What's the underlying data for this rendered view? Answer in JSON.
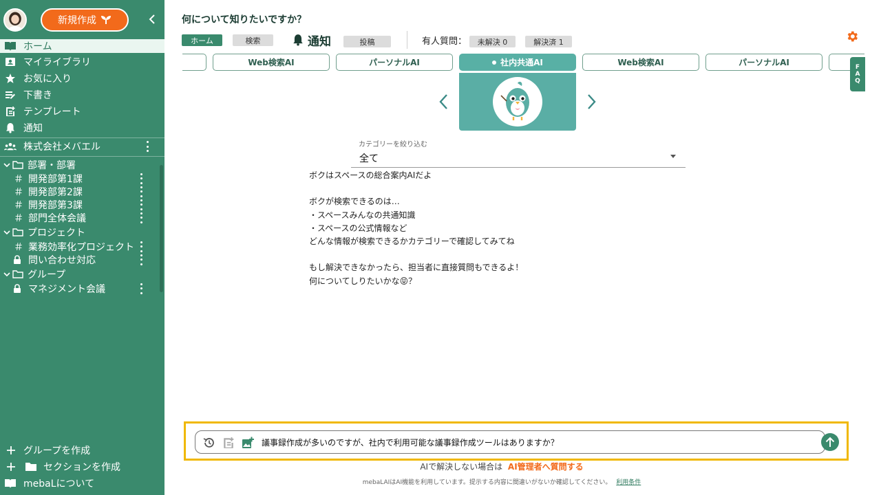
{
  "sidebar": {
    "new_button": "新規作成",
    "nav": [
      {
        "label": "ホーム",
        "icon": "book-icon"
      },
      {
        "label": "マイライブラリ",
        "icon": "id-card-icon"
      },
      {
        "label": "お気に入り",
        "icon": "star-icon"
      },
      {
        "label": "下書き",
        "icon": "draft-icon"
      },
      {
        "label": "テンプレート",
        "icon": "template-icon"
      },
      {
        "label": "通知",
        "icon": "bell-icon"
      }
    ],
    "company": "株式会社メバエル",
    "sections": [
      {
        "label": "部署・部署",
        "items": [
          "開発部第1課",
          "開発部第2課",
          "開発部第3課",
          "部門全体会議"
        ]
      },
      {
        "label": "プロジェクト",
        "items": [
          "業務効率化プロジェクト",
          "問い合わせ対応"
        ]
      },
      {
        "label": "グループ",
        "items": [
          "マネジメント会議"
        ]
      }
    ],
    "bottom": {
      "create_group": "グループを作成",
      "create_section": "セクションを作成",
      "about": "mebaLについて"
    }
  },
  "header": {
    "title": "何について知りたいですか？",
    "home_chip": "ホーム",
    "search_chip": "検索",
    "notif_title": "通知",
    "post_chip": "投稿",
    "human_label": "有人質問：",
    "unresolved": "未解決 0",
    "resolved": "解決済 1"
  },
  "ai_tabs": [
    "Web検索AI",
    "パーソナルAI",
    "社内共通AI",
    "Web検索AI",
    "パーソナルAI"
  ],
  "active_tab": "社内共通AI",
  "faq_tab": [
    "F",
    "A",
    "Q"
  ],
  "category": {
    "label": "カテゴリーを絞り込む",
    "value": "全て"
  },
  "intro_lines": [
    "ボクはスペースの総合案内AIだよ",
    "",
    "ボクが検索できるのは…",
    "・スペースみんなの共通知識",
    "・スペースの公式情報など",
    "どんな情報が検索できるかカテゴリーで確認してみてね",
    "",
    "もし解決できなかったら、担当者に直接質問もできるよ！",
    "何についてしりたいかな😝？"
  ],
  "input": {
    "value": "議事録作成が多いのですが、社内で利用可能な議事録作成ツールはありますか？"
  },
  "footer": {
    "ask_prefix": "AIで解決しない場合は",
    "ask_link": "AI管理者へ質問する",
    "disclaimer": "mebaLAIはAI機能を利用しています。提示する内容に間違いがないか確認してください。",
    "terms": "利用条件"
  },
  "colors": {
    "sidebar": "#3a8a6d",
    "accent_orange": "#f26a1b",
    "active_tab": "#58b0a5",
    "highlight": "#f0b800"
  }
}
